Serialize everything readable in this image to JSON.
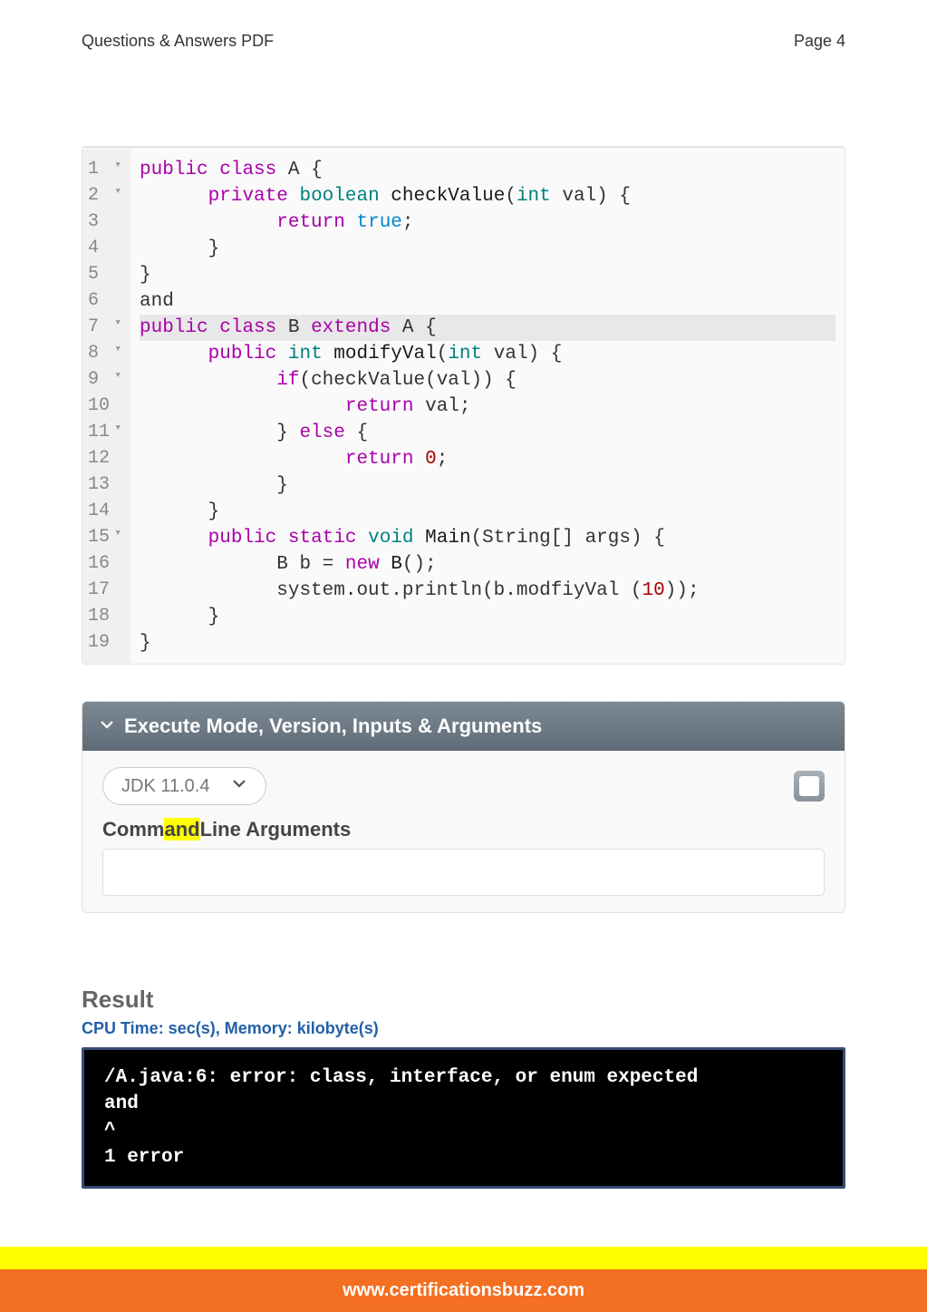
{
  "header": {
    "left": "Questions & Answers PDF",
    "right": "Page 4"
  },
  "code": {
    "lines": [
      {
        "num": "1",
        "fold": true,
        "tokens": [
          {
            "t": "public",
            "c": "kw"
          },
          {
            "t": " ",
            "c": ""
          },
          {
            "t": "class",
            "c": "kw"
          },
          {
            "t": " A {",
            "c": ""
          }
        ]
      },
      {
        "num": "2",
        "fold": true,
        "tokens": [
          {
            "t": "      ",
            "c": ""
          },
          {
            "t": "private",
            "c": "kw"
          },
          {
            "t": " ",
            "c": ""
          },
          {
            "t": "boolean",
            "c": "typekw"
          },
          {
            "t": " ",
            "c": ""
          },
          {
            "t": "checkValue",
            "c": "name"
          },
          {
            "t": "(",
            "c": ""
          },
          {
            "t": "int",
            "c": "typekw"
          },
          {
            "t": " val) {",
            "c": ""
          }
        ]
      },
      {
        "num": "3",
        "fold": false,
        "tokens": [
          {
            "t": "            ",
            "c": ""
          },
          {
            "t": "return",
            "c": "ret"
          },
          {
            "t": " ",
            "c": ""
          },
          {
            "t": "true",
            "c": "lit"
          },
          {
            "t": ";",
            "c": ""
          }
        ]
      },
      {
        "num": "4",
        "fold": false,
        "tokens": [
          {
            "t": "      }",
            "c": ""
          }
        ]
      },
      {
        "num": "5",
        "fold": false,
        "tokens": [
          {
            "t": "}",
            "c": ""
          }
        ]
      },
      {
        "num": "6",
        "fold": false,
        "tokens": [
          {
            "t": "and",
            "c": ""
          }
        ]
      },
      {
        "num": "7",
        "fold": true,
        "active": true,
        "tokens": [
          {
            "t": "public",
            "c": "kw"
          },
          {
            "t": " ",
            "c": ""
          },
          {
            "t": "class",
            "c": "kw"
          },
          {
            "t": " B ",
            "c": ""
          },
          {
            "t": "extends",
            "c": "kw"
          },
          {
            "t": " A {",
            "c": ""
          }
        ]
      },
      {
        "num": "8",
        "fold": true,
        "tokens": [
          {
            "t": "      ",
            "c": ""
          },
          {
            "t": "public",
            "c": "kw"
          },
          {
            "t": " ",
            "c": ""
          },
          {
            "t": "int",
            "c": "typekw"
          },
          {
            "t": " ",
            "c": ""
          },
          {
            "t": "modifyVal",
            "c": "name"
          },
          {
            "t": "(",
            "c": ""
          },
          {
            "t": "int",
            "c": "typekw"
          },
          {
            "t": " val) {",
            "c": ""
          }
        ]
      },
      {
        "num": "9",
        "fold": true,
        "tokens": [
          {
            "t": "            ",
            "c": ""
          },
          {
            "t": "if",
            "c": "kw"
          },
          {
            "t": "(checkValue(val)) {",
            "c": ""
          }
        ]
      },
      {
        "num": "10",
        "fold": false,
        "tokens": [
          {
            "t": "                  ",
            "c": ""
          },
          {
            "t": "return",
            "c": "ret"
          },
          {
            "t": " val;",
            "c": ""
          }
        ]
      },
      {
        "num": "11",
        "fold": true,
        "tokens": [
          {
            "t": "            } ",
            "c": ""
          },
          {
            "t": "else",
            "c": "kw"
          },
          {
            "t": " {",
            "c": ""
          }
        ]
      },
      {
        "num": "12",
        "fold": false,
        "tokens": [
          {
            "t": "                  ",
            "c": ""
          },
          {
            "t": "return",
            "c": "ret"
          },
          {
            "t": " ",
            "c": ""
          },
          {
            "t": "0",
            "c": "num"
          },
          {
            "t": ";",
            "c": ""
          }
        ]
      },
      {
        "num": "13",
        "fold": false,
        "tokens": [
          {
            "t": "            }",
            "c": ""
          }
        ]
      },
      {
        "num": "14",
        "fold": false,
        "tokens": [
          {
            "t": "      }",
            "c": ""
          }
        ]
      },
      {
        "num": "15",
        "fold": true,
        "tokens": [
          {
            "t": "      ",
            "c": ""
          },
          {
            "t": "public",
            "c": "kw"
          },
          {
            "t": " ",
            "c": ""
          },
          {
            "t": "static",
            "c": "kw"
          },
          {
            "t": " ",
            "c": ""
          },
          {
            "t": "void",
            "c": "typekw"
          },
          {
            "t": " ",
            "c": ""
          },
          {
            "t": "Main",
            "c": "name"
          },
          {
            "t": "(String[] args) {",
            "c": ""
          }
        ]
      },
      {
        "num": "16",
        "fold": false,
        "tokens": [
          {
            "t": "            B b = ",
            "c": ""
          },
          {
            "t": "new",
            "c": "kw"
          },
          {
            "t": " ",
            "c": ""
          },
          {
            "t": "B",
            "c": "name"
          },
          {
            "t": "();",
            "c": ""
          }
        ]
      },
      {
        "num": "17",
        "fold": false,
        "tokens": [
          {
            "t": "            system.out.println(b.modfiyVal (",
            "c": ""
          },
          {
            "t": "10",
            "c": "num"
          },
          {
            "t": "));",
            "c": ""
          }
        ]
      },
      {
        "num": "18",
        "fold": false,
        "tokens": [
          {
            "t": "      }",
            "c": ""
          }
        ]
      },
      {
        "num": "19",
        "fold": false,
        "tokens": [
          {
            "t": "}",
            "c": ""
          }
        ]
      }
    ]
  },
  "exec": {
    "title": "Execute Mode, Version, Inputs & Arguments",
    "jdk": "JDK 11.0.4",
    "cmd_prefix": "Comm",
    "cmd_highlight": "and",
    "cmd_suffix": "Line Arguments"
  },
  "result": {
    "title": "Result",
    "subtitle": "CPU Time: sec(s), Memory: kilobyte(s)",
    "terminal": "/A.java:6: error: class, interface, or enum expected\nand\n^\n1 error"
  },
  "footer": {
    "url": "www.certificationsbuzz.com"
  }
}
